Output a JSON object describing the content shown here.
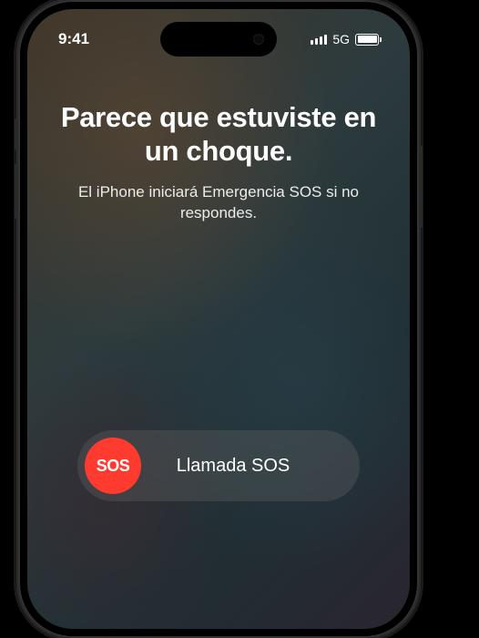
{
  "status": {
    "time": "9:41",
    "network": "5G"
  },
  "alert": {
    "headline": "Parece que estuviste en un choque.",
    "subtext": "El iPhone iniciará Emergencia SOS si no respondes."
  },
  "sos": {
    "knob_label": "SOS",
    "slider_label": "Llamada SOS"
  },
  "colors": {
    "sos_red": "#ff3b30"
  }
}
